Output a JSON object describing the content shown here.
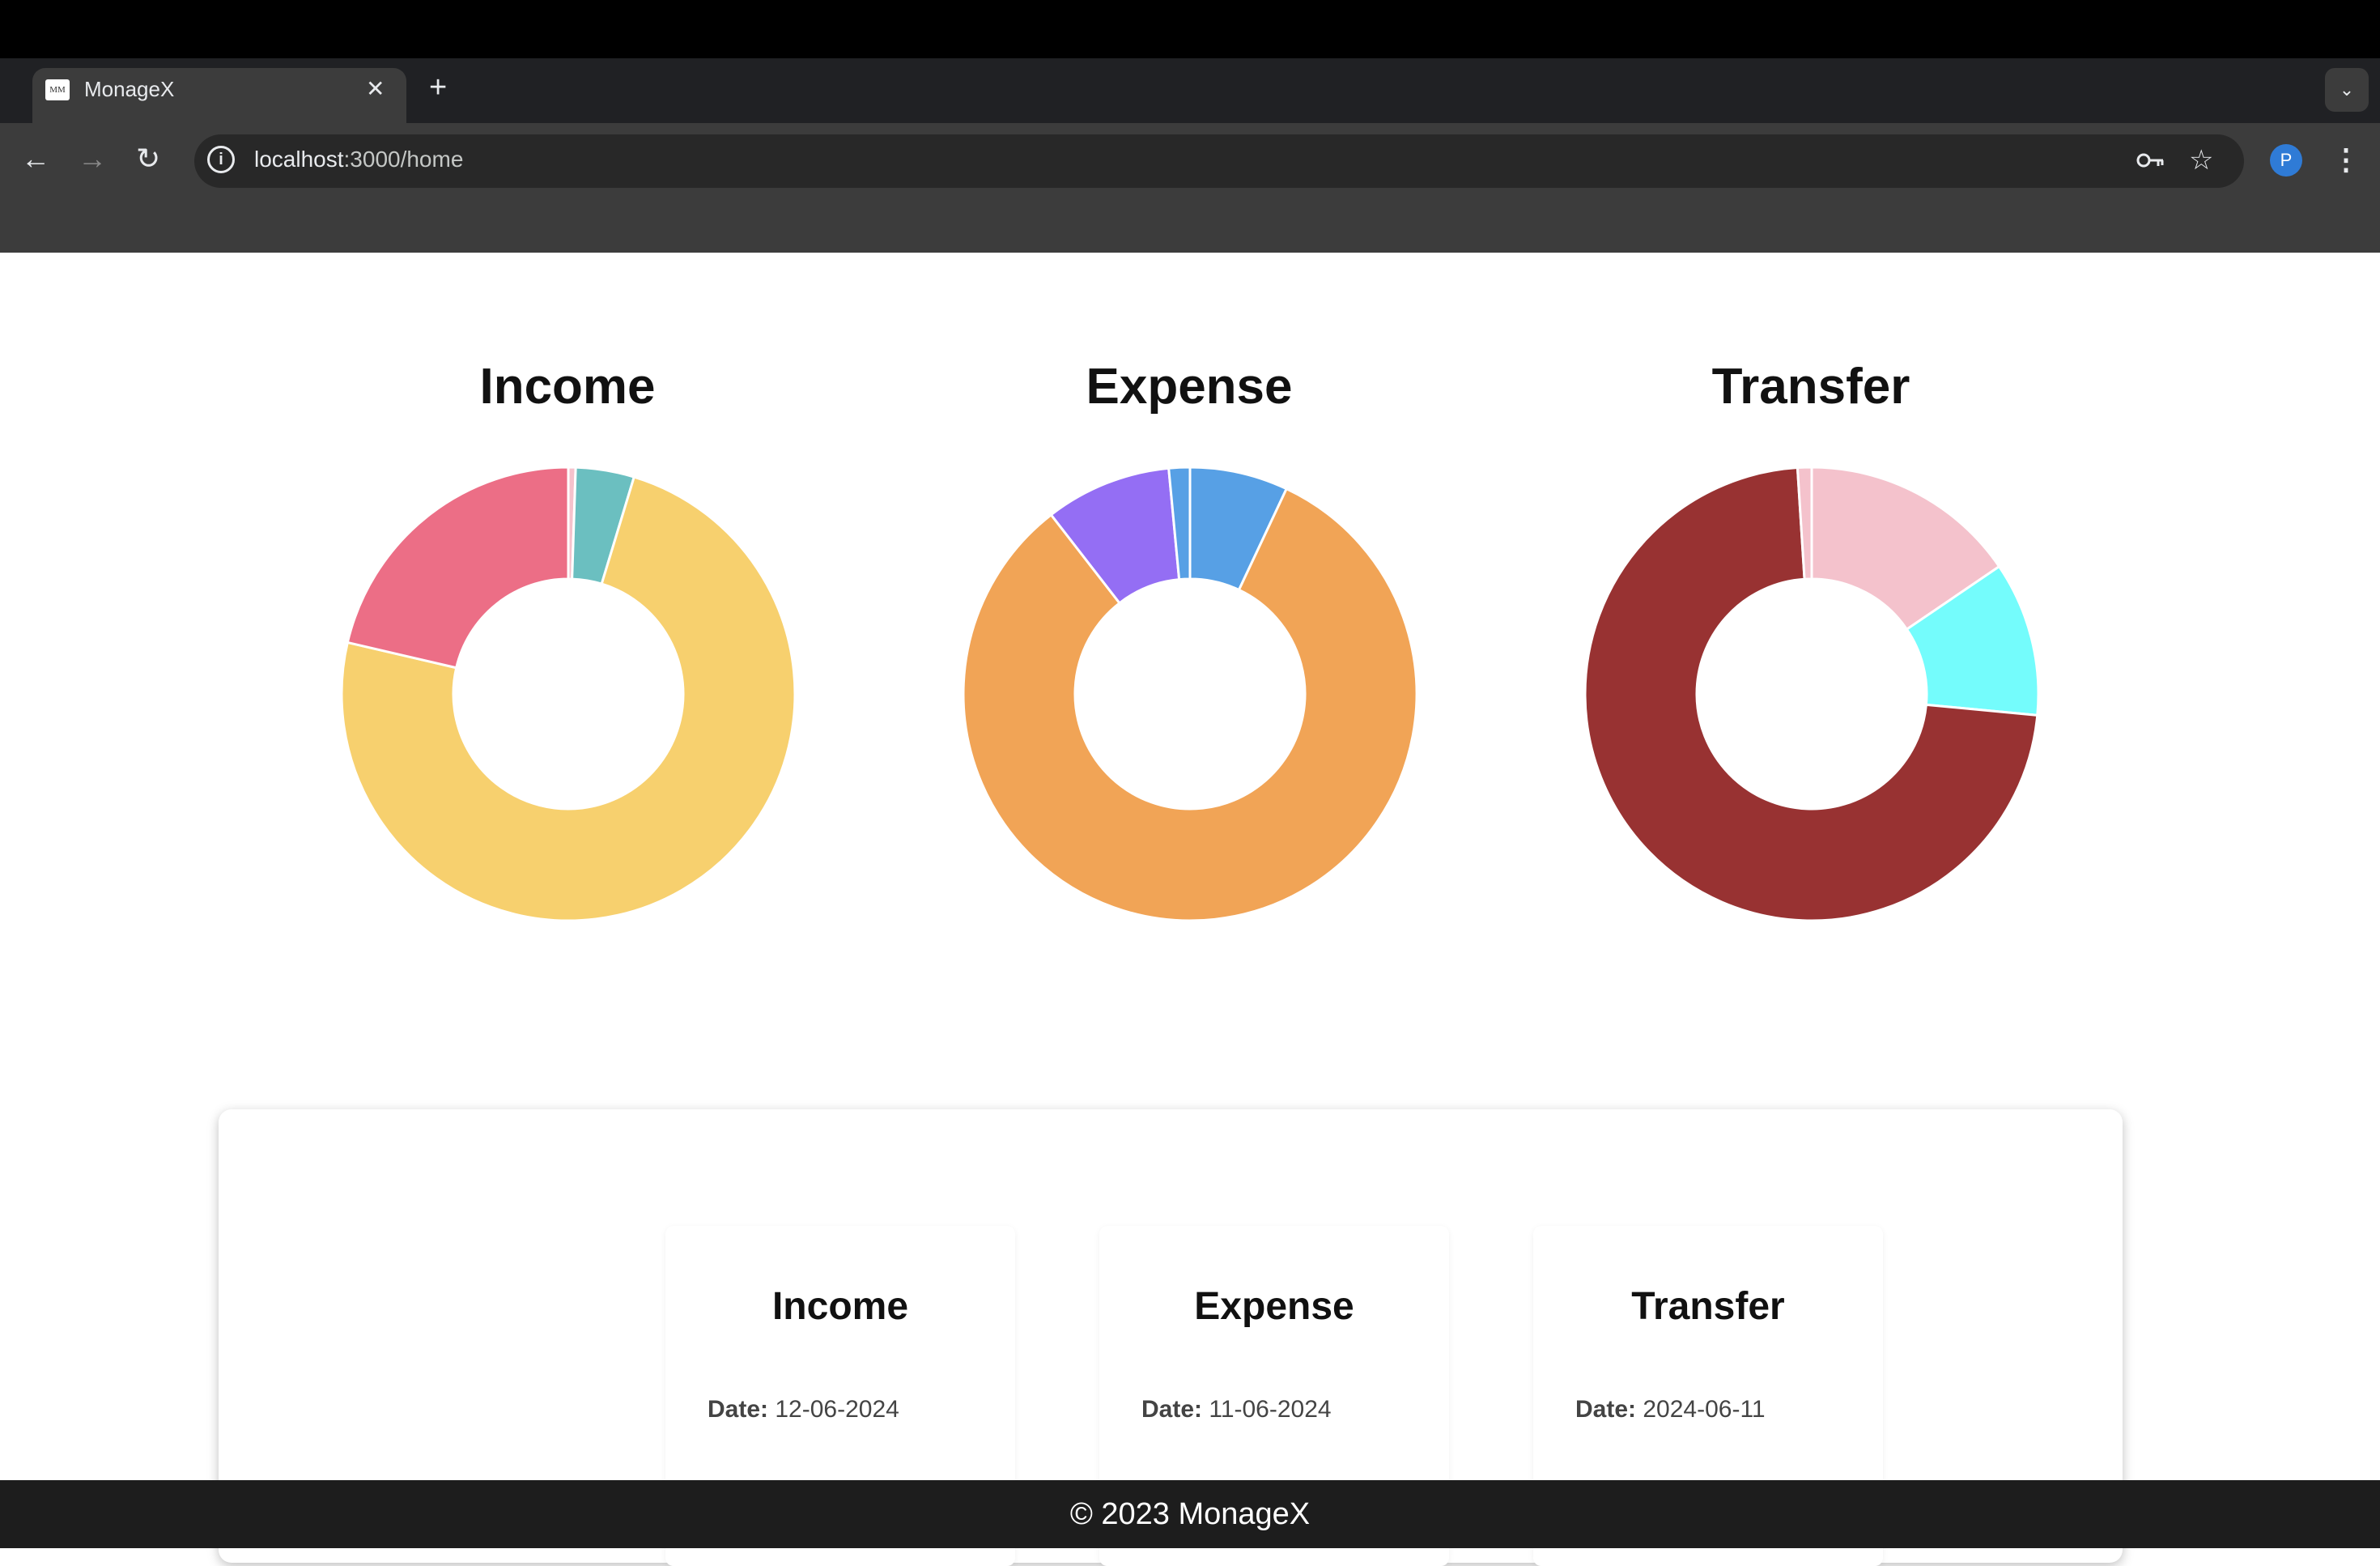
{
  "browser": {
    "tab_title": "MonageX",
    "favicon_text": "MM",
    "close_glyph": "✕",
    "new_tab_glyph": "+",
    "url_host": "localhost",
    "url_path": ":3000/home",
    "profile_initial": "P",
    "icons": [
      "back-icon",
      "forward-icon",
      "reload-icon",
      "site-info-icon",
      "key-icon",
      "star-icon",
      "chevron-down-icon",
      "more-vert-icon"
    ]
  },
  "chart_data": [
    {
      "type": "pie",
      "title": "Income",
      "values": [
        0.5,
        4,
        71,
        20.5
      ],
      "colors": [
        "#f5c2cc",
        "#6bbfc0",
        "#f7d06e",
        "#ec6e86"
      ]
    },
    {
      "type": "pie",
      "title": "Expense",
      "values": [
        7,
        82.5,
        9,
        1.5
      ],
      "colors": [
        "#57a0e5",
        "#f1a456",
        "#946ef4",
        "#57a0e5"
      ]
    },
    {
      "type": "pie",
      "title": "Transfer",
      "values": [
        15.5,
        11,
        72.5,
        1
      ],
      "colors": [
        "#f4c2cc",
        "#74fcfc",
        "#983232",
        "#f4c2cc"
      ]
    }
  ],
  "cards": [
    {
      "title": "Income",
      "date_label": "Date:",
      "date_value": "12-06-2024"
    },
    {
      "title": "Expense",
      "date_label": "Date:",
      "date_value": "11-06-2024"
    },
    {
      "title": "Transfer",
      "date_label": "Date:",
      "date_value": "2024-06-11"
    }
  ],
  "footer": {
    "text": "© 2023 MonageX"
  }
}
